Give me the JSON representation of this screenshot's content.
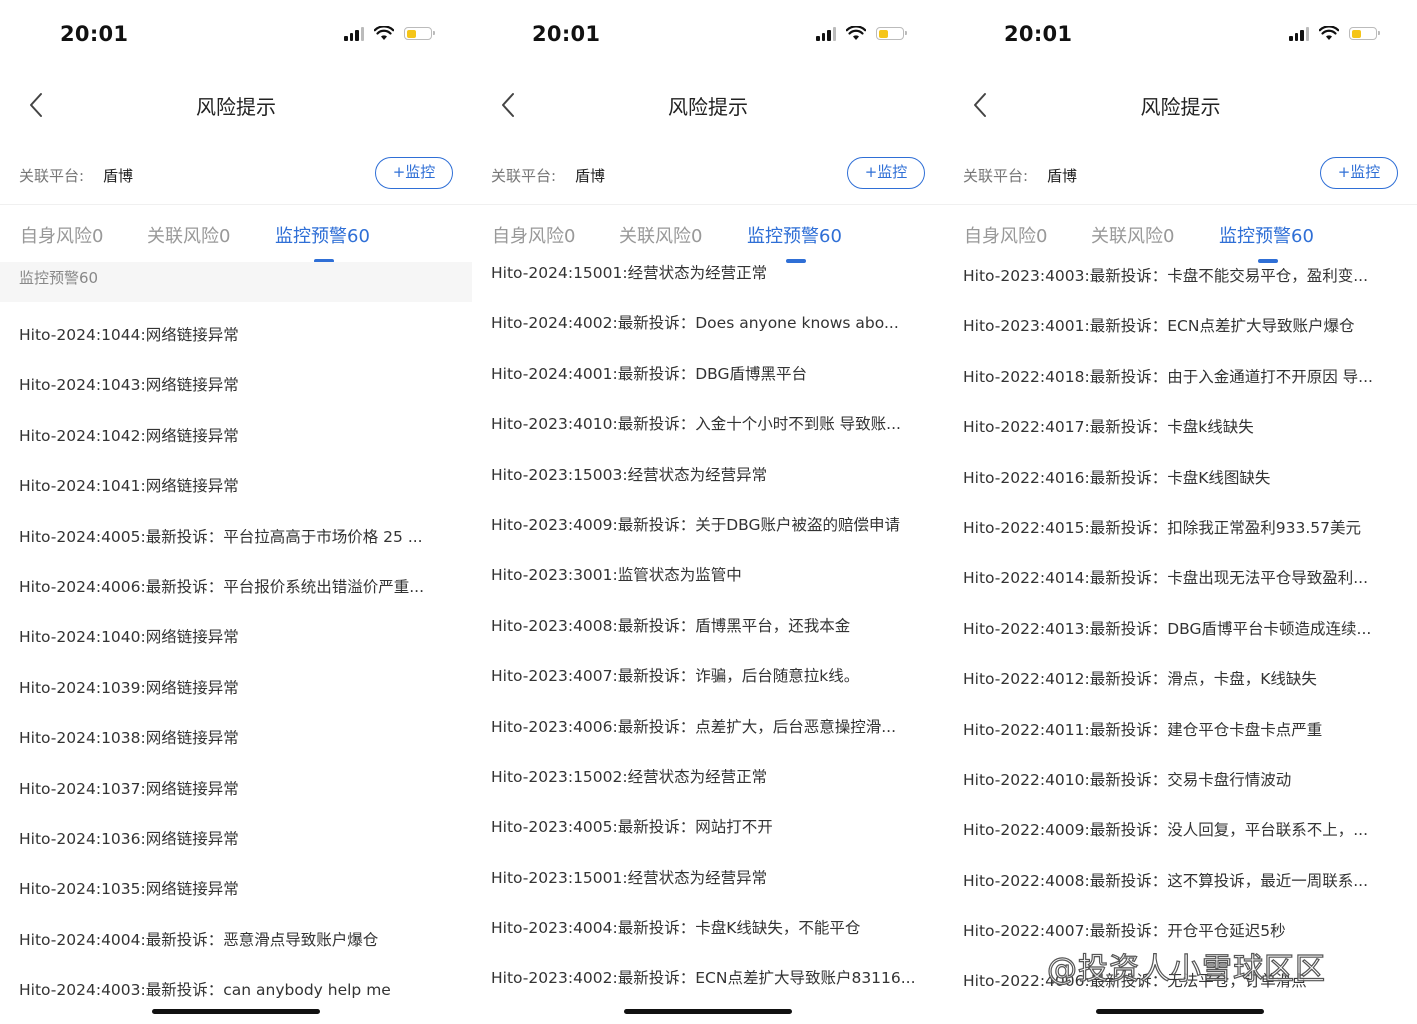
{
  "status": {
    "time": "20:01"
  },
  "screens": [
    {
      "nav_title": "风险提示",
      "platform_label": "关联平台:",
      "platform_name": "盾博",
      "monitor_button": "+监控",
      "tabs": [
        "自身风险0",
        "关联风险0",
        "监控预警60"
      ],
      "active_tab": 2,
      "section_header": "监控预警60",
      "items": [
        "Hito-2024:1044:网络链接异常",
        "Hito-2024:1043:网络链接异常",
        "Hito-2024:1042:网络链接异常",
        "Hito-2024:1041:网络链接异常",
        "Hito-2024:4005:最新投诉：平台拉高高于市场价格 25 ...",
        "Hito-2024:4006:最新投诉：平台报价系统出错溢价严重...",
        "Hito-2024:1040:网络链接异常",
        "Hito-2024:1039:网络链接异常",
        "Hito-2024:1038:网络链接异常",
        "Hito-2024:1037:网络链接异常",
        "Hito-2024:1036:网络链接异常",
        "Hito-2024:1035:网络链接异常",
        "Hito-2024:4004:最新投诉：恶意滑点导致账户爆仓",
        "Hito-2024:4003:最新投诉：can anybody help me"
      ]
    },
    {
      "nav_title": "风险提示",
      "platform_label": "关联平台:",
      "platform_name": "盾博",
      "monitor_button": "+监控",
      "tabs": [
        "自身风险0",
        "关联风险0",
        "监控预警60"
      ],
      "active_tab": 2,
      "section_header": "",
      "items": [
        "Hito-2024:15001:经营状态为经营正常",
        "Hito-2024:4002:最新投诉：Does anyone knows abo...",
        "Hito-2024:4001:最新投诉：DBG盾博黑平台",
        "Hito-2023:4010:最新投诉：入金十个小时不到账 导致账...",
        "Hito-2023:15003:经营状态为经营异常",
        "Hito-2023:4009:最新投诉：关于DBG账户被盗的赔偿申请",
        "Hito-2023:3001:监管状态为监管中",
        "Hito-2023:4008:最新投诉：盾博黑平台，还我本金",
        "Hito-2023:4007:最新投诉：诈骗，后台随意拉k线。",
        "Hito-2023:4006:最新投诉：点差扩大，后台恶意操控滑...",
        "Hito-2023:15002:经营状态为经营正常",
        "Hito-2023:4005:最新投诉：网站打不开",
        "Hito-2023:15001:经营状态为经营异常",
        "Hito-2023:4004:最新投诉：卡盘K线缺失，不能平仓",
        "Hito-2023:4002:最新投诉：ECN点差扩大导致账户83116..."
      ]
    },
    {
      "nav_title": "风险提示",
      "platform_label": "关联平台:",
      "platform_name": "盾博",
      "monitor_button": "+监控",
      "tabs": [
        "自身风险0",
        "关联风险0",
        "监控预警60"
      ],
      "active_tab": 2,
      "section_header": "",
      "items": [
        "Hito-2023:4003:最新投诉：卡盘不能交易平仓，盈利变...",
        "Hito-2023:4001:最新投诉：ECN点差扩大导致账户爆仓",
        "Hito-2022:4018:最新投诉：由于入金通道打不开原因 导...",
        "Hito-2022:4017:最新投诉：卡盘k线缺失",
        "Hito-2022:4016:最新投诉：卡盘K线图缺失",
        "Hito-2022:4015:最新投诉：扣除我正常盈利933.57美元",
        "Hito-2022:4014:最新投诉：卡盘出现无法平仓导致盈利...",
        "Hito-2022:4013:最新投诉：DBG盾博平台卡顿造成连续...",
        "Hito-2022:4012:最新投诉：滑点，卡盘，K线缺失",
        "Hito-2022:4011:最新投诉：建仓平仓卡盘卡点严重",
        "Hito-2022:4010:最新投诉：交易卡盘行情波动",
        "Hito-2022:4009:最新投诉：没人回复，平台联系不上，...",
        "Hito-2022:4008:最新投诉：这不算投诉，最近一周联系...",
        "Hito-2022:4007:最新投诉：开仓平仓延迟5秒",
        "Hito-2022:4006:最新投诉：无法平仓，订单滑点"
      ]
    }
  ],
  "watermark": "@投资人小雪球区区",
  "colors": {
    "accent": "#2f6fd6",
    "battery": "#f5c518"
  }
}
